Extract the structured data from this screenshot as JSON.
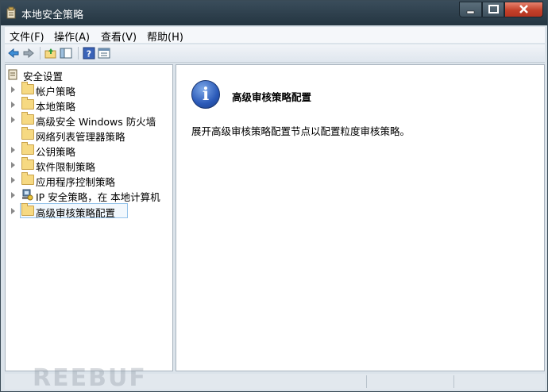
{
  "window": {
    "title": "本地安全策略"
  },
  "menu": [
    "文件(F)",
    "操作(A)",
    "查看(V)",
    "帮助(H)"
  ],
  "tree": {
    "root": "安全设置",
    "items": [
      {
        "label": "帐户策略",
        "expandable": true,
        "icon": "policy-folder-icon"
      },
      {
        "label": "本地策略",
        "expandable": true,
        "icon": "policy-folder-icon"
      },
      {
        "label": "高级安全 Windows 防火墙",
        "expandable": true,
        "icon": "folder-icon"
      },
      {
        "label": "网络列表管理器策略",
        "expandable": false,
        "icon": "folder-icon"
      },
      {
        "label": "公钥策略",
        "expandable": true,
        "icon": "folder-icon"
      },
      {
        "label": "软件限制策略",
        "expandable": true,
        "icon": "folder-icon"
      },
      {
        "label": "应用程序控制策略",
        "expandable": true,
        "icon": "folder-icon"
      },
      {
        "label": "IP 安全策略，在 本地计算机",
        "expandable": true,
        "icon": "ip-security-icon"
      },
      {
        "label": "高级审核策略配置",
        "expandable": true,
        "icon": "folder-icon",
        "selected": true
      }
    ]
  },
  "detail": {
    "heading": "高级审核策略配置",
    "description": "展开高级审核策略配置节点以配置粒度审核策略。"
  },
  "watermark": "REEBUF"
}
